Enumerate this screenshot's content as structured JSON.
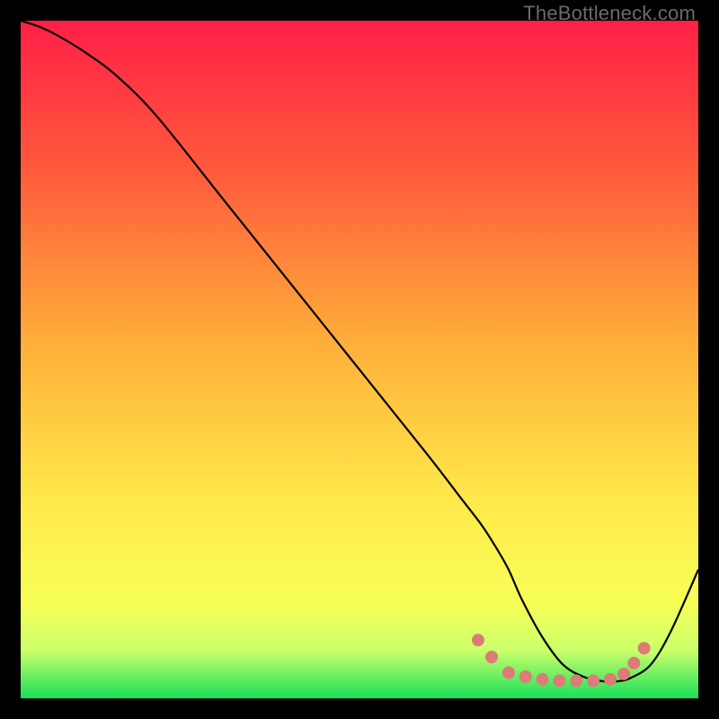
{
  "watermark": "TheBottleneck.com",
  "chart_data": {
    "type": "line",
    "title": "",
    "xlabel": "",
    "ylabel": "",
    "xlim": [
      0,
      100
    ],
    "ylim": [
      0,
      100
    ],
    "gradient_stops": [
      {
        "pct": 0,
        "color": "#ff1f47"
      },
      {
        "pct": 22,
        "color": "#ff5a3c"
      },
      {
        "pct": 48,
        "color": "#ffb03a"
      },
      {
        "pct": 70,
        "color": "#ffe74a"
      },
      {
        "pct": 86,
        "color": "#f7ff57"
      },
      {
        "pct": 93,
        "color": "#caff6a"
      },
      {
        "pct": 100,
        "color": "#18e05a"
      }
    ],
    "series": [
      {
        "name": "bottleneck-curve",
        "color": "#000000",
        "x": [
          0,
          3,
          6,
          10,
          14,
          20,
          30,
          40,
          50,
          60,
          65,
          68,
          70,
          72,
          74,
          77,
          80,
          83,
          86,
          88,
          90,
          93,
          96,
          100
        ],
        "y": [
          100,
          99,
          97.5,
          95,
          92,
          86,
          73.5,
          61,
          48.5,
          36,
          29.5,
          25.6,
          22.5,
          19,
          14.5,
          9,
          5,
          3.2,
          2.5,
          2.5,
          3,
          5,
          10,
          19
        ]
      }
    ],
    "markers": {
      "name": "highlighted-points",
      "color": "#dd7b78",
      "radius": 7,
      "points": [
        {
          "x": 67.5,
          "y": 8.6
        },
        {
          "x": 69.5,
          "y": 6.1
        },
        {
          "x": 72.0,
          "y": 3.8
        },
        {
          "x": 74.5,
          "y": 3.2
        },
        {
          "x": 77.0,
          "y": 2.8
        },
        {
          "x": 79.5,
          "y": 2.6
        },
        {
          "x": 82.0,
          "y": 2.6
        },
        {
          "x": 84.5,
          "y": 2.6
        },
        {
          "x": 87.0,
          "y": 2.8
        },
        {
          "x": 89.0,
          "y": 3.6
        },
        {
          "x": 90.5,
          "y": 5.2
        },
        {
          "x": 92.0,
          "y": 7.4
        }
      ]
    }
  }
}
